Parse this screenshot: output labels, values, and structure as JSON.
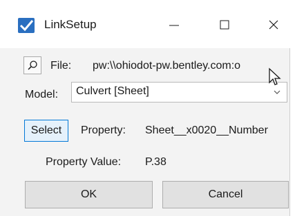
{
  "window": {
    "title": "LinkSetup",
    "accent_color": "#0078d7"
  },
  "caption_buttons": [
    "minimize-icon",
    "maximize-icon",
    "close-icon"
  ],
  "file": {
    "label": "File:",
    "value": "pw:\\\\ohiodot-pw.bentley.com:o",
    "icon": "search-icon"
  },
  "model": {
    "label": "Model:",
    "selected": "Culvert [Sheet]",
    "icon": "chevron-down-icon"
  },
  "property": {
    "select_label": "Select",
    "label": "Property:",
    "value": "Sheet__x0020__Number"
  },
  "property_value": {
    "label": "Property Value:",
    "value": "P.38"
  },
  "buttons": {
    "ok": "OK",
    "cancel": "Cancel"
  }
}
